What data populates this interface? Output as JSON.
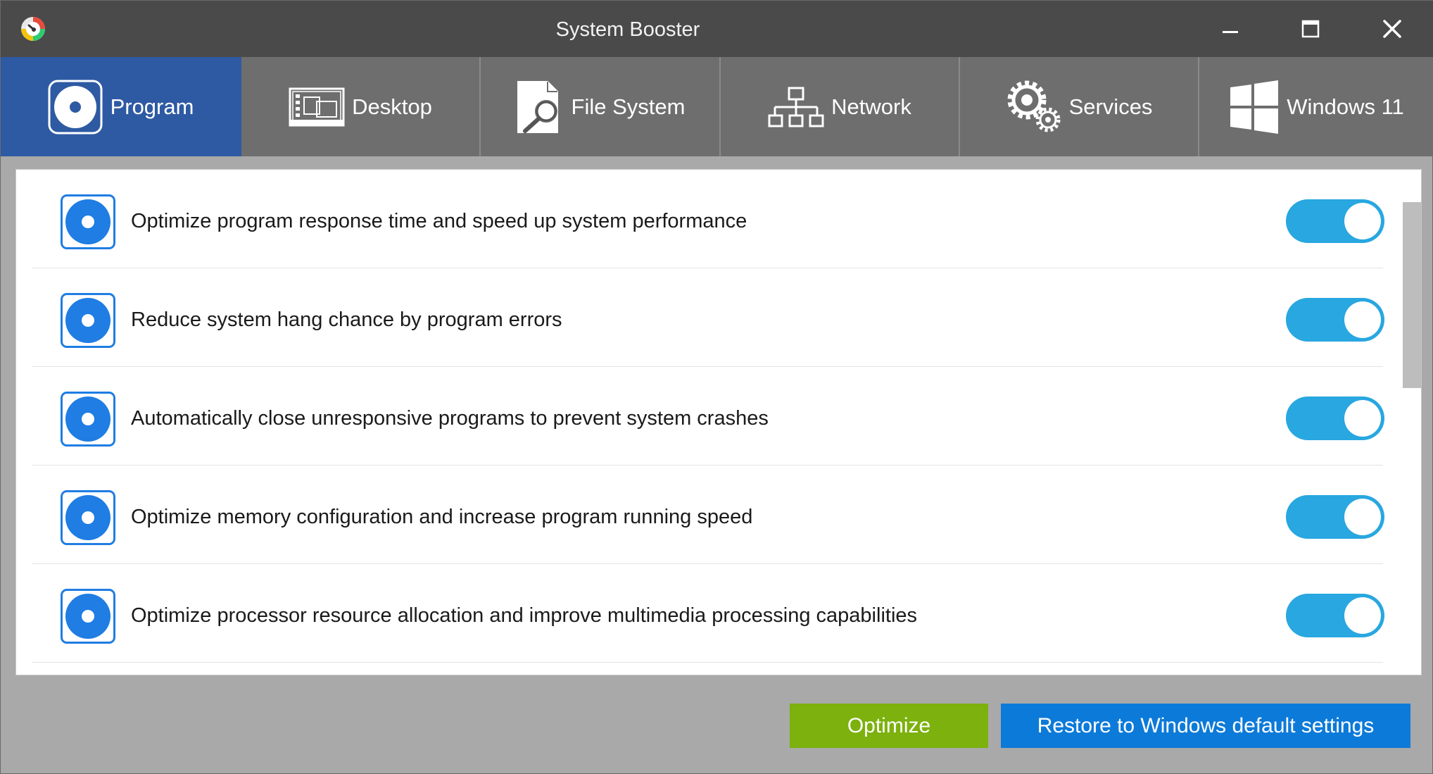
{
  "window": {
    "title": "System Booster"
  },
  "tabs": [
    {
      "label": "Program",
      "icon": "program-disc-icon",
      "active": true
    },
    {
      "label": "Desktop",
      "icon": "desktop-icon",
      "active": false
    },
    {
      "label": "File System",
      "icon": "file-search-icon",
      "active": false
    },
    {
      "label": "Network",
      "icon": "network-icon",
      "active": false
    },
    {
      "label": "Services",
      "icon": "gears-icon",
      "active": false
    },
    {
      "label": "Windows 11",
      "icon": "windows-logo-icon",
      "active": false
    }
  ],
  "options": [
    {
      "label": "Optimize program response time and speed up system performance",
      "enabled": true
    },
    {
      "label": "Reduce system hang chance by program errors",
      "enabled": true
    },
    {
      "label": "Automatically close unresponsive programs to prevent system crashes",
      "enabled": true
    },
    {
      "label": "Optimize memory configuration and increase program running speed",
      "enabled": true
    },
    {
      "label": "Optimize processor resource allocation and improve multimedia processing capabilities",
      "enabled": true
    }
  ],
  "buttons": {
    "optimize": "Optimize",
    "restore": "Restore to Windows default settings"
  },
  "colors": {
    "titlebar": "#4a4a4a",
    "tab_active": "#2e5aa3",
    "tab_inactive": "#6e6e6e",
    "toggle_on": "#28a7e0",
    "icon_blue": "#1f7de3",
    "optimize_green": "#7cb10e",
    "restore_blue": "#0c7ad9"
  }
}
